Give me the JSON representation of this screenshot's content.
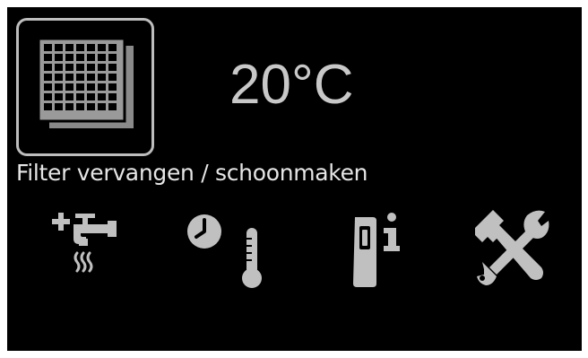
{
  "display": {
    "temperature": "20°C",
    "status_message": "Filter vervangen / schoonmaken"
  },
  "icons": {
    "filter": "filter-grid-icon",
    "hot_water": "hot-water-tap-icon",
    "schedule_temperature": "clock-thermometer-icon",
    "device_info": "device-info-icon",
    "service": "hammer-wrench-icon"
  },
  "colors": {
    "background": "#000000",
    "icon": "#c0c0c0",
    "text": "#e6e6e6"
  }
}
